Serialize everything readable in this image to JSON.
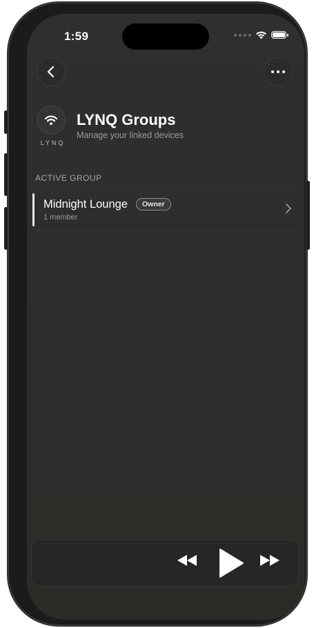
{
  "status_bar": {
    "time": "1:59",
    "battery_level": 1.0
  },
  "nav": {
    "back_icon": "chevron-left-icon",
    "more_icon": "ellipsis-icon"
  },
  "brand": {
    "logo_icon": "wifi-icon",
    "logo_text": "LYNQ"
  },
  "header": {
    "title": "LYNQ Groups",
    "subtitle": "Manage your linked devices"
  },
  "active_group": {
    "section_label": "ACTIVE GROUP",
    "name": "Midnight Lounge",
    "badge": "Owner",
    "members": "1 member"
  },
  "player": {
    "controls": [
      "rewind-icon",
      "play-icon",
      "fast-forward-icon"
    ]
  },
  "colors": {
    "background": "#2e2e2d",
    "text_primary": "#ffffff",
    "text_secondary": "#9a9a9a",
    "accent": "#e8e8e8"
  }
}
